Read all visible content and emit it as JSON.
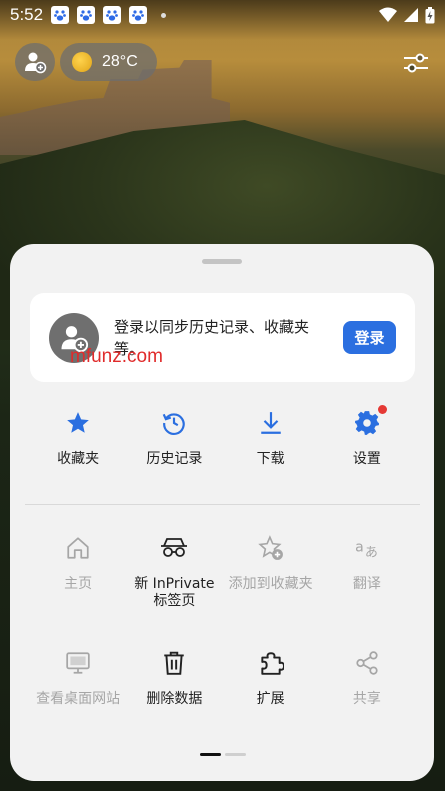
{
  "status_bar": {
    "time": "5:52",
    "app_icons": [
      "baidu-icon",
      "baidu-icon",
      "baidu-icon",
      "baidu-icon"
    ]
  },
  "top": {
    "temperature": "28°C"
  },
  "signin": {
    "message": "登录以同步历史记录、收藏夹等。",
    "button_label": "登录"
  },
  "watermark": "mfunz.com",
  "menu_row1": [
    {
      "label": "收藏夹",
      "icon": "star-icon",
      "enabled": true
    },
    {
      "label": "历史记录",
      "icon": "history-icon",
      "enabled": true
    },
    {
      "label": "下载",
      "icon": "download-icon",
      "enabled": true
    },
    {
      "label": "设置",
      "icon": "gear-icon",
      "enabled": true
    }
  ],
  "menu_row2": [
    {
      "label": "主页",
      "icon": "home-icon",
      "enabled": false
    },
    {
      "label": "新 InPrivate\n标签页",
      "icon": "inprivate-icon",
      "enabled": true
    },
    {
      "label": "添加到收藏夹",
      "icon": "add-favorite-icon",
      "enabled": false
    },
    {
      "label": "翻译",
      "icon": "translate-icon",
      "enabled": false
    }
  ],
  "menu_row3": [
    {
      "label": "查看桌面网站",
      "icon": "desktop-icon",
      "enabled": false
    },
    {
      "label": "删除数据",
      "icon": "trash-icon",
      "enabled": true
    },
    {
      "label": "扩展",
      "icon": "puzzle-icon",
      "enabled": true
    },
    {
      "label": "共享",
      "icon": "share-icon",
      "enabled": false
    }
  ],
  "colors": {
    "accent": "#2b6fe0",
    "disabled": "#a6a6a6",
    "badge": "#e53935"
  }
}
